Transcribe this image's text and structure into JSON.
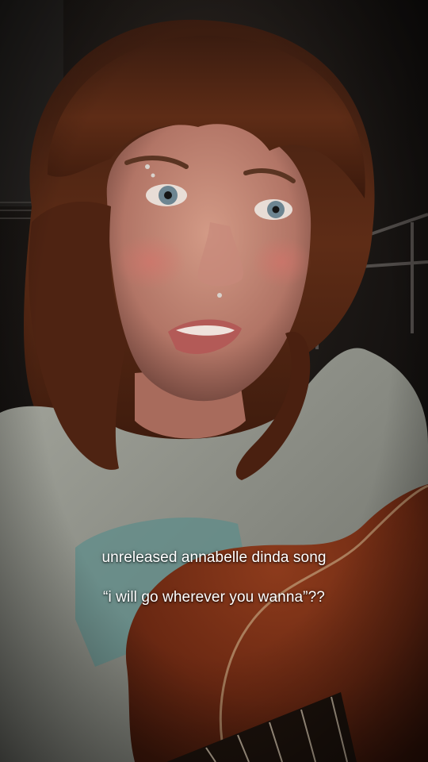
{
  "overlay": {
    "caption_line_1": "unreleased annabelle dinda song",
    "caption_line_2": "“i will go wherever you wanna”??"
  },
  "colors": {
    "background": "#141110",
    "hair": "#5a2a16",
    "skin": "#c58a77",
    "shirt": "#9a9c93",
    "guitar": "#6e2b14",
    "caption": "#ffffff"
  }
}
